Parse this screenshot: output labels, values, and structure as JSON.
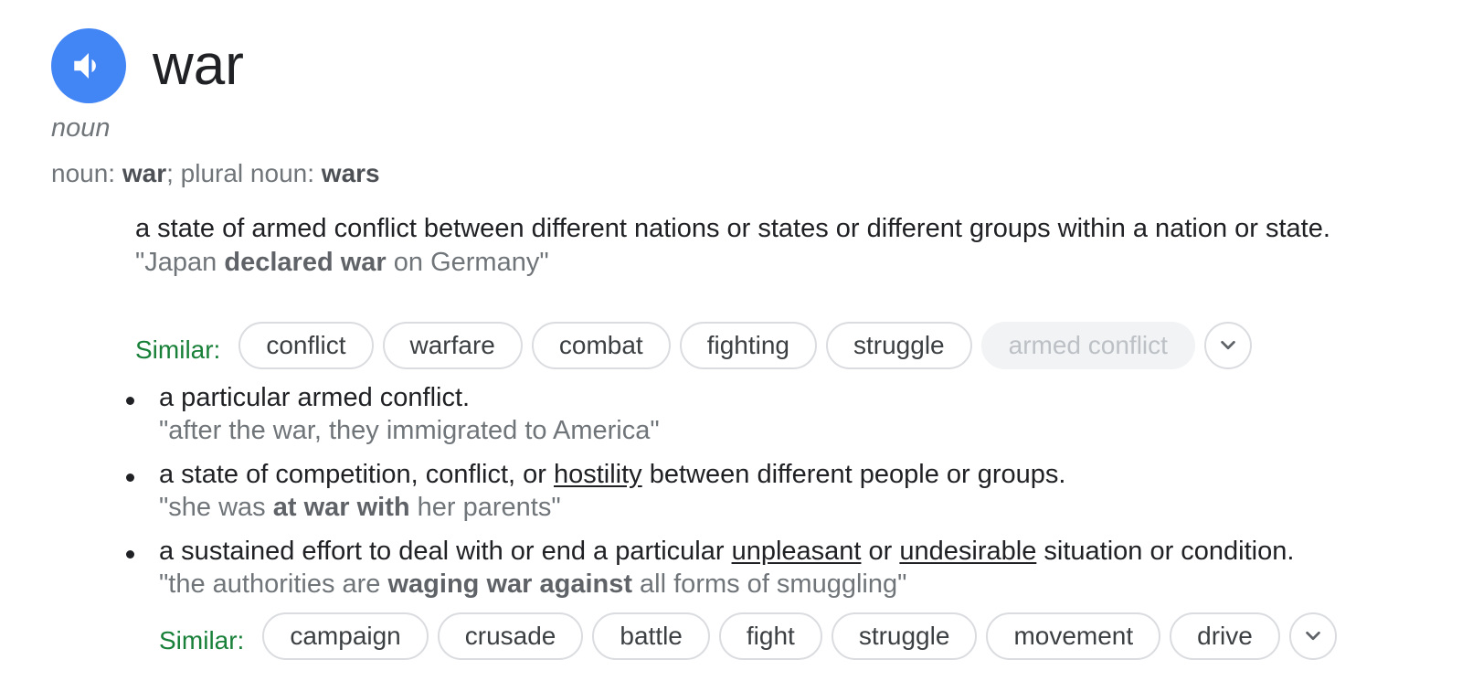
{
  "entry": {
    "word": "war",
    "part_of_speech": "noun",
    "forms": {
      "noun_label": "noun",
      "noun": "war",
      "plural_label": "plural noun",
      "plural": "wars"
    }
  },
  "main_definition": {
    "text": "a state of armed conflict between different nations or states or different groups within a nation or state.",
    "example": {
      "before": "\"Japan ",
      "bold": "declared war",
      "after": " on Germany\""
    },
    "similar_label": "Similar:",
    "similar": [
      "conflict",
      "warfare",
      "combat",
      "fighting",
      "struggle"
    ],
    "similar_disabled": "armed conflict"
  },
  "sub_definitions": [
    {
      "text": "a particular armed conflict.",
      "example": "\"after the war, they immigrated to America\""
    },
    {
      "text_before": "a state of competition, conflict, or ",
      "link": "hostility",
      "text_after": " between different people or groups.",
      "example": {
        "before": "\"she was ",
        "bold": "at war with",
        "after": " her parents\""
      }
    },
    {
      "text_before": "a sustained effort to deal with or end a particular ",
      "link1": "unpleasant",
      "text_middle": " or ",
      "link2": "undesirable",
      "text_after": " situation or condition.",
      "example": {
        "before": "\"the authorities are ",
        "bold": "waging war against",
        "after": " all forms of smuggling\""
      }
    }
  ],
  "bottom_similar": {
    "label": "Similar:",
    "chips": [
      "campaign",
      "crusade",
      "battle",
      "fight",
      "struggle",
      "movement",
      "drive"
    ]
  },
  "colors": {
    "accent_blue": "#4285f4",
    "similar_green": "#188038",
    "text_gray": "#70757a"
  }
}
